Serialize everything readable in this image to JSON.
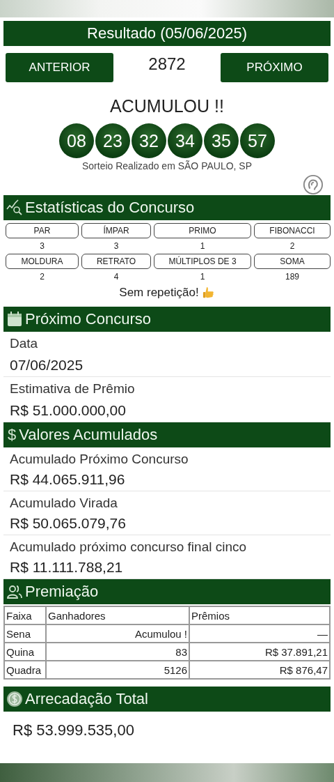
{
  "result": {
    "title": "Resultado (05/06/2025)",
    "prev_button": "ANTERIOR",
    "contest_number": "2872",
    "next_button": "PRÓXIMO",
    "status": "ACUMULOU !!",
    "numbers": [
      "08",
      "23",
      "32",
      "34",
      "35",
      "57"
    ],
    "location": "Sorteio Realizado em SÃO PAULO, SP"
  },
  "statistics": {
    "title": "Estatísticas do Concurso",
    "items": [
      {
        "label": "PAR",
        "value": "3"
      },
      {
        "label": "ÍMPAR",
        "value": "3"
      },
      {
        "label": "PRIMO",
        "value": "1"
      },
      {
        "label": "FIBONACCI",
        "value": "2"
      },
      {
        "label": "MOLDURA",
        "value": "2"
      },
      {
        "label": "RETRATO",
        "value": "4"
      },
      {
        "label": "MÚLTIPLOS DE 3",
        "value": "1"
      },
      {
        "label": "SOMA",
        "value": "189"
      }
    ],
    "note": "Sem repetição!"
  },
  "next_contest": {
    "title": "Próximo Concurso",
    "fields": [
      {
        "label": "Data",
        "value": "07/06/2025"
      },
      {
        "label": "Estimativa de Prêmio",
        "value": "R$ 51.000.000,00"
      }
    ]
  },
  "accumulated": {
    "icon": "$",
    "title": "Valores Acumulados",
    "fields": [
      {
        "label": "Acumulado Próximo Concurso",
        "value": "R$ 44.065.911,96"
      },
      {
        "label": "Acumulado Virada",
        "value": "R$ 50.065.079,76"
      },
      {
        "label": "Acumulado próximo concurso final cinco",
        "value": "R$ 11.111.788,21"
      }
    ]
  },
  "prizes": {
    "title": "Premiação",
    "columns": [
      "Faixa",
      "Ganhadores",
      "Prêmios"
    ],
    "rows": [
      [
        "Sena",
        "Acumulou !",
        "—"
      ],
      [
        "Quina",
        "83",
        "R$ 37.891,21"
      ],
      [
        "Quadra",
        "5126",
        "R$ 876,47"
      ]
    ]
  },
  "total": {
    "title": "Arrecadação Total",
    "value": "R$ 53.999.535,00"
  }
}
